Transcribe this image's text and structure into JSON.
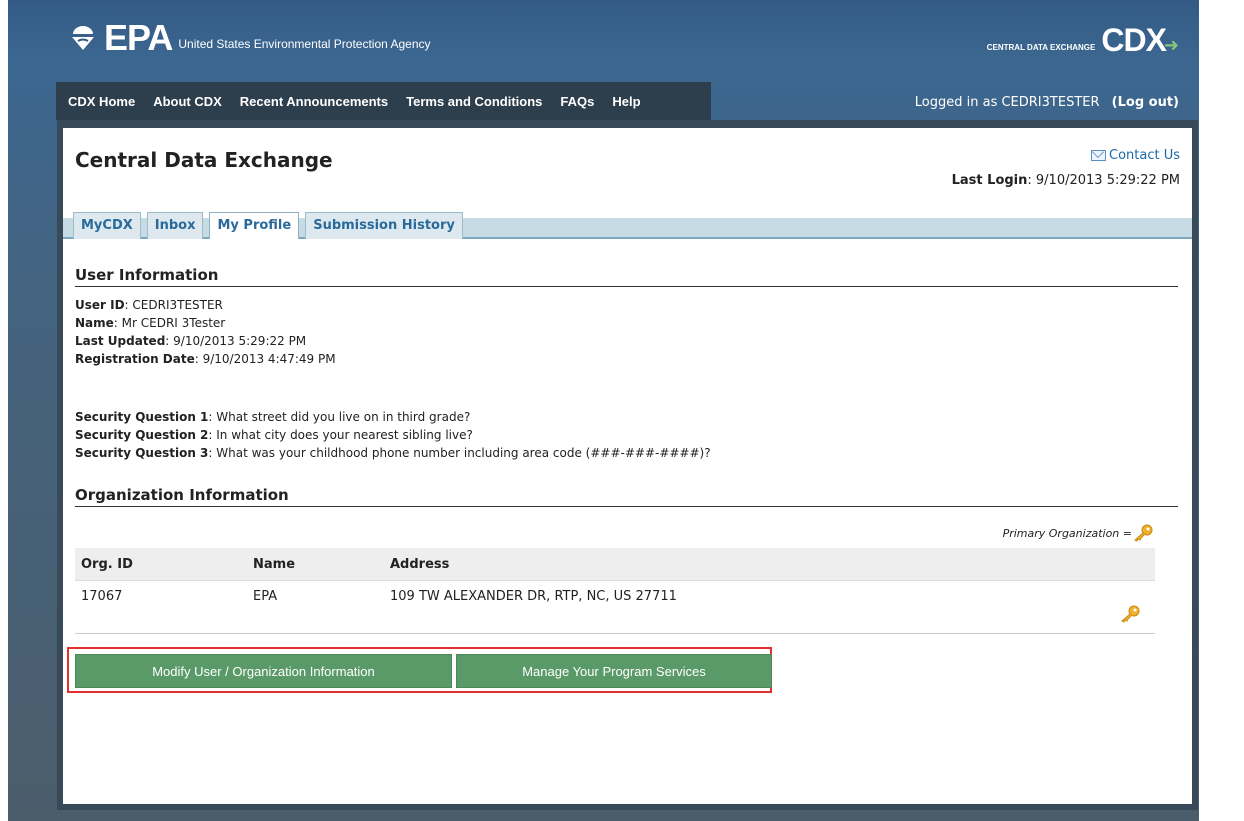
{
  "header": {
    "logo_text": "EPA",
    "agency_name": "United States Environmental Protection Agency",
    "cdx_small": "CENTRAL DATA EXCHANGE",
    "cdx_big": "CDX"
  },
  "nav": {
    "items": [
      "CDX Home",
      "About CDX",
      "Recent Announcements",
      "Terms and Conditions",
      "FAQs",
      "Help"
    ],
    "logged_in_text": "Logged in as CEDRI3TESTER",
    "logout_label": "(Log out)"
  },
  "page": {
    "title": "Central Data Exchange",
    "contact_label": "Contact Us",
    "last_login_label": "Last Login",
    "last_login_value": ": 9/10/2013 5:29:22 PM"
  },
  "tabs": [
    "MyCDX",
    "Inbox",
    "My Profile",
    "Submission History"
  ],
  "user_info": {
    "section_title": "User Information",
    "user_id_label": "User ID",
    "user_id_value": ": CEDRI3TESTER",
    "name_label": "Name",
    "name_value": ": Mr CEDRI 3Tester",
    "last_updated_label": "Last Updated",
    "last_updated_value": ": 9/10/2013 5:29:22 PM",
    "registration_label": "Registration Date",
    "registration_value": ": 9/10/2013 4:47:49 PM",
    "sq1_label": "Security Question 1",
    "sq1_value": ": What street did you live on in third grade?",
    "sq2_label": "Security Question 2",
    "sq2_value": ": In what city does your nearest sibling live?",
    "sq3_label": "Security Question 3",
    "sq3_value": ": What was your childhood phone number including area code (###-###-####)?"
  },
  "org_info": {
    "section_title": "Organization Information",
    "primary_org_label": "Primary Organization =",
    "columns": [
      "Org. ID",
      "Name",
      "Address"
    ],
    "rows": [
      {
        "org_id": "17067",
        "name": "EPA",
        "address": "109 TW ALEXANDER DR, RTP, NC, US 27711"
      }
    ]
  },
  "buttons": {
    "modify_label": "Modify User / Organization Information",
    "manage_label": "Manage Your Program Services"
  },
  "colors": {
    "button_green": "#5a9a68",
    "highlight_red": "#e03030",
    "nav_bar": "#2d3e4d",
    "tab_text": "#2a6a9b"
  },
  "icons": {
    "logo": "epa-logo-icon",
    "contact": "envelope-icon",
    "primary": "key-icon"
  }
}
